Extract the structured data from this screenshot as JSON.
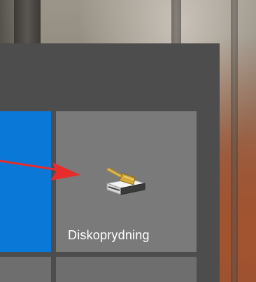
{
  "start_menu": {
    "tiles": [
      {
        "label": ""
      },
      {
        "label": "Diskoprydning",
        "icon": "disk-cleanup-icon"
      }
    ]
  },
  "annotation": {
    "arrow_color": "#e82c2c",
    "icon": "red-arrow"
  },
  "colors": {
    "menu_bg": "#4d4d4d",
    "tile_bg": "#7a7a7a",
    "accent_tile": "#0a78d7"
  }
}
